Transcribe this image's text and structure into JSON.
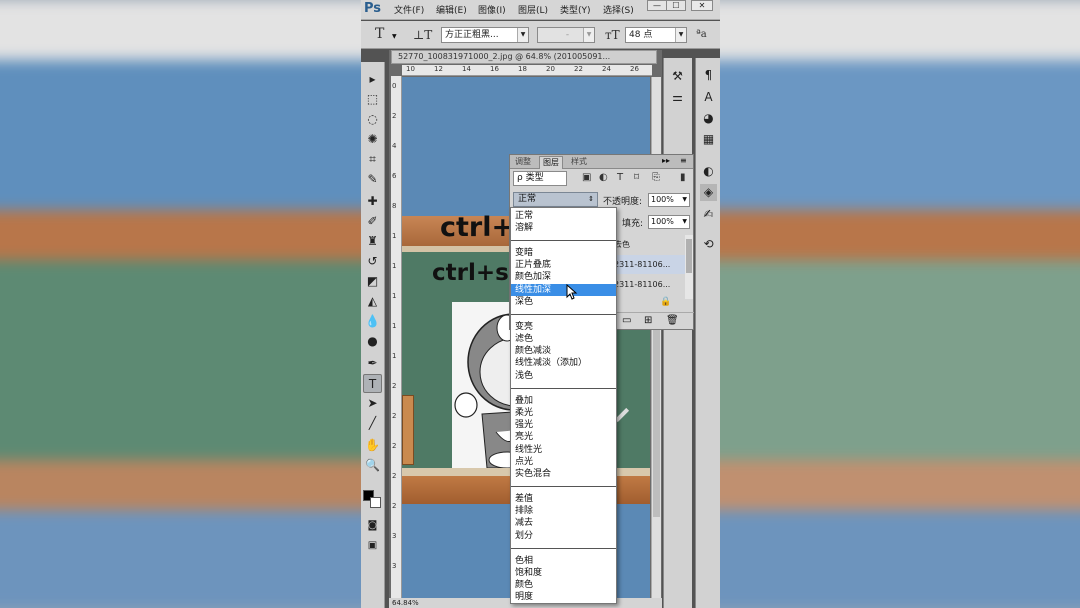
{
  "app": {
    "logo": "Ps"
  },
  "menu": [
    "文件(F)",
    "编辑(E)",
    "图像(I)",
    "图层(L)",
    "类型(Y)",
    "选择(S)"
  ],
  "window_controls": {
    "minimize": "—",
    "restore": "☐",
    "close": "✕"
  },
  "options": {
    "font_family": "方正正粗黑...",
    "font_style": "-",
    "font_size": "48 点",
    "aa_label": "ªa"
  },
  "document": {
    "tab_title": "52770_100831971000_2.jpg @ 64.8% (201005091...",
    "zoom": "64.84%",
    "ruler_h": [
      "10",
      "12",
      "14",
      "16",
      "18",
      "20",
      "22",
      "24",
      "26"
    ],
    "ruler_v": [
      "0",
      "2",
      "4",
      "6",
      "8",
      "1",
      "1",
      "1",
      "1",
      "1",
      "2",
      "2",
      "2",
      "2",
      "2",
      "3",
      "3"
    ],
    "canvas_text": [
      "ctrl+j",
      "ctrl+s"
    ]
  },
  "layers_panel": {
    "tabs": [
      "调整",
      "图层",
      "样式"
    ],
    "filter_label": "ρ 类型",
    "blend_mode": "正常",
    "opacity_label": "不透明度:",
    "opacity_value": "100%",
    "fill_label": "填充:",
    "fill_value": "100%",
    "layers": [
      "去色",
      "2311-81106...",
      "2311-81106..."
    ]
  },
  "blend_menu": {
    "groups": [
      [
        "正常",
        "溶解"
      ],
      [
        "变暗",
        "正片叠底",
        "颜色加深",
        "线性加深",
        "深色"
      ],
      [
        "变亮",
        "滤色",
        "颜色减淡",
        "线性减淡（添加）",
        "浅色"
      ],
      [
        "叠加",
        "柔光",
        "强光",
        "亮光",
        "线性光",
        "点光",
        "实色混合"
      ],
      [
        "差值",
        "排除",
        "减去",
        "划分"
      ],
      [
        "色相",
        "饱和度",
        "颜色",
        "明度"
      ]
    ],
    "selected": "线性加深"
  },
  "colors": {
    "selected": "#3a8ee6",
    "canvas": "#5b89b5",
    "chalkboard": "#4f7a65"
  }
}
